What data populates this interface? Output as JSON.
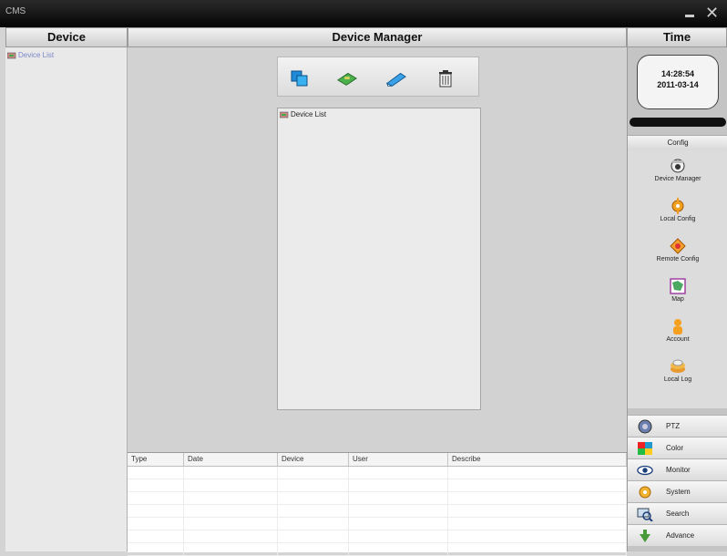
{
  "window": {
    "title": "CMS"
  },
  "columns": {
    "device": "Device",
    "manager": "Device Manager",
    "time": "Time"
  },
  "left": {
    "tree_root": "Device List"
  },
  "center": {
    "toolbar": [
      "add-device-icon",
      "modify-device-icon",
      "edit-device-icon",
      "delete-icon"
    ],
    "device_list_label": "Device List"
  },
  "log": {
    "columns": [
      "Type",
      "Date",
      "Device",
      "User",
      "Describe"
    ]
  },
  "clock": {
    "time": "14:28:54",
    "date": "2011-03-14"
  },
  "config": {
    "header": "Config",
    "items": [
      "Device Manager",
      "Local Config",
      "Remote Config",
      "Map",
      "Account",
      "Local Log"
    ]
  },
  "nav": [
    "PTZ",
    "Color",
    "Monitor",
    "System",
    "Search",
    "Advance"
  ]
}
